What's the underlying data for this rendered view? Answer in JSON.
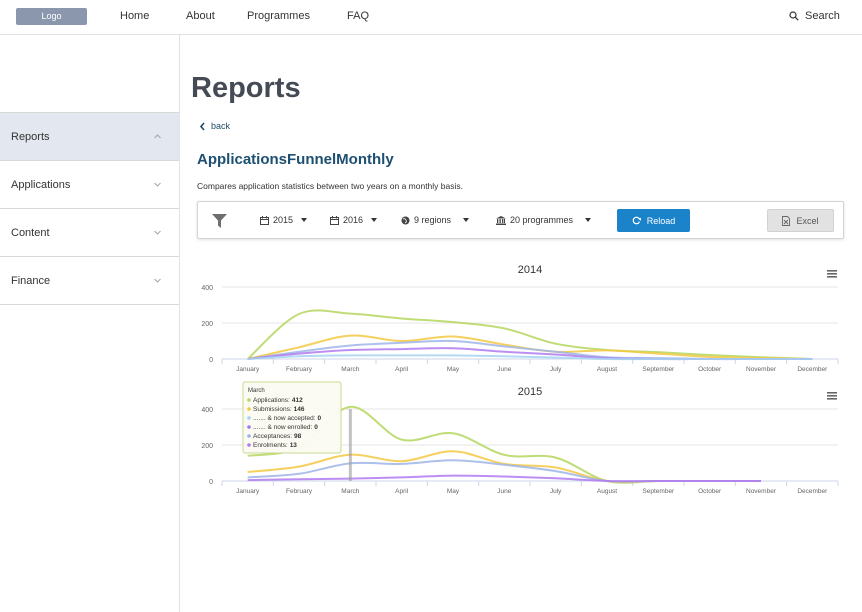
{
  "nav": {
    "logo": "Logo",
    "links": [
      "Home",
      "About",
      "Programmes",
      "FAQ"
    ],
    "search": "Search"
  },
  "sidebar": {
    "items": [
      {
        "label": "Reports",
        "active": true,
        "chevron": "chevron-up-icon"
      },
      {
        "label": "Applications",
        "active": false,
        "chevron": "chevron-down-icon"
      },
      {
        "label": "Content",
        "active": false,
        "chevron": "chevron-down-icon"
      },
      {
        "label": "Finance",
        "active": false,
        "chevron": "chevron-down-icon"
      }
    ]
  },
  "main": {
    "title": "Reports",
    "back": "back",
    "report_title": "ApplicationsFunnelMonthly",
    "description": "Compares application statistics between two years on a monthly basis."
  },
  "toolbar": {
    "year_a": "2015",
    "year_b": "2016",
    "regions": "9 regions",
    "programmes": "20 programmes",
    "reload": "Reload",
    "excel": "Excel"
  },
  "colors": {
    "accent": "#1a83c9",
    "applications": "#b5d65e",
    "submissions": "#f5c842",
    "now_accepted": "#a4d4f0",
    "now_enrolled": "#9a7cf0",
    "acceptances": "#9fb5e8",
    "enrolments": "#b07af0"
  },
  "chart_data": [
    {
      "type": "line",
      "title": "2014",
      "categories": [
        "January",
        "February",
        "March",
        "April",
        "May",
        "June",
        "July",
        "August",
        "September",
        "October",
        "November",
        "December"
      ],
      "ylim": [
        0,
        400
      ],
      "yticks": [
        0,
        200,
        400
      ],
      "series": [
        {
          "name": "Applications",
          "color": "#b5d65e",
          "values": [
            0,
            250,
            252,
            225,
            205,
            170,
            85,
            50,
            38,
            22,
            10,
            0
          ]
        },
        {
          "name": "Submissions",
          "color": "#f5c842",
          "values": [
            0,
            65,
            130,
            100,
            125,
            80,
            40,
            48,
            30,
            12,
            5,
            0
          ]
        },
        {
          "name": "Acceptances",
          "color": "#9fb5e8",
          "values": [
            0,
            40,
            75,
            90,
            100,
            70,
            40,
            10,
            5,
            0,
            0,
            0
          ]
        },
        {
          "name": "Enrolments",
          "color": "#b07af0",
          "values": [
            0,
            30,
            50,
            55,
            60,
            40,
            25,
            5,
            0,
            0,
            0,
            0
          ]
        },
        {
          "name": "....... & now accepted",
          "color": "#a4d4f0",
          "values": [
            0,
            15,
            20,
            20,
            20,
            15,
            8,
            0,
            0,
            0,
            0,
            0
          ]
        }
      ]
    },
    {
      "type": "line",
      "title": "2015",
      "categories": [
        "January",
        "February",
        "March",
        "April",
        "May",
        "June",
        "July",
        "August",
        "September",
        "October",
        "November",
        "December"
      ],
      "ylim": [
        0,
        400
      ],
      "yticks": [
        0,
        200,
        400
      ],
      "series": [
        {
          "name": "Applications",
          "color": "#b5d65e",
          "values": [
            140,
            185,
            412,
            230,
            265,
            145,
            130,
            0,
            0,
            0,
            0,
            null
          ]
        },
        {
          "name": "Submissions",
          "color": "#f5c842",
          "values": [
            50,
            80,
            146,
            110,
            165,
            95,
            75,
            0,
            0,
            0,
            0,
            null
          ]
        },
        {
          "name": "Acceptances",
          "color": "#9fb5e8",
          "values": [
            20,
            40,
            98,
            95,
            115,
            90,
            55,
            0,
            0,
            0,
            0,
            null
          ]
        },
        {
          "name": "Enrolments",
          "color": "#b07af0",
          "values": [
            5,
            10,
            13,
            20,
            30,
            25,
            15,
            0,
            0,
            0,
            0,
            null
          ]
        }
      ],
      "tooltip": {
        "title": "March",
        "rows": [
          {
            "label": "Applications:",
            "value": "412",
            "color": "#b5d65e"
          },
          {
            "label": "Submissions:",
            "value": "146",
            "color": "#f5c842"
          },
          {
            "label": "....... & now accepted:",
            "value": "0",
            "color": "#a4d4f0"
          },
          {
            "label": "....... & now enrolled:",
            "value": "0",
            "color": "#9a7cf0"
          },
          {
            "label": "Acceptances:",
            "value": "98",
            "color": "#9fb5e8"
          },
          {
            "label": "Enrolments:",
            "value": "13",
            "color": "#b07af0"
          }
        ]
      }
    }
  ]
}
